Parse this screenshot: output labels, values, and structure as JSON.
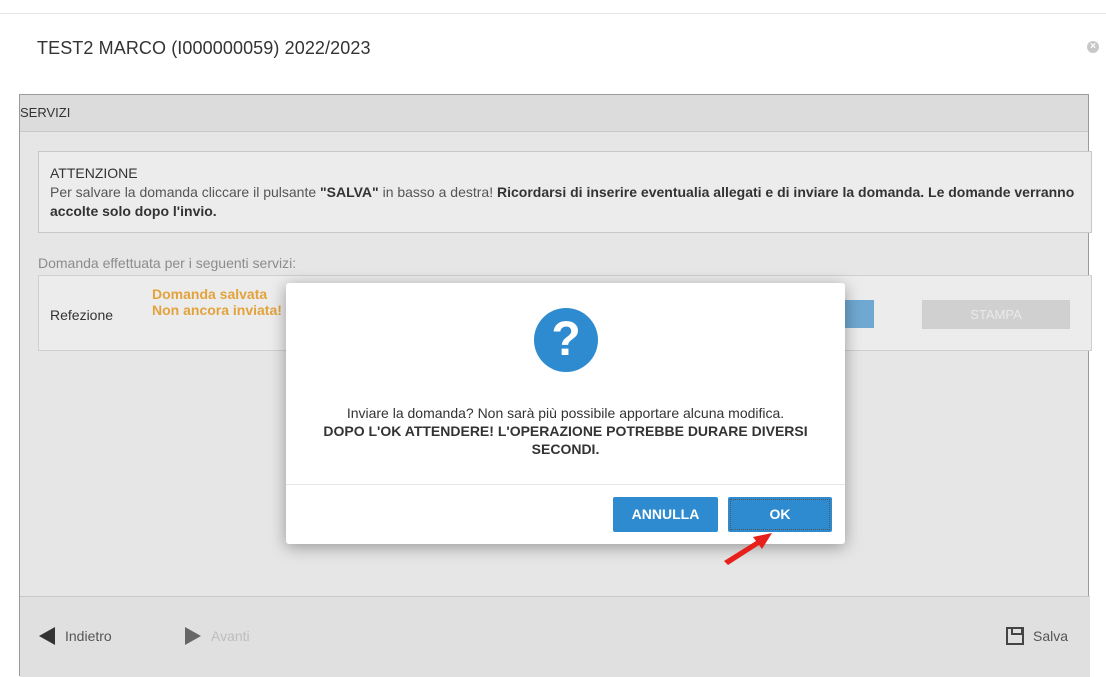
{
  "window": {
    "title": "TEST2 MARCO (I000000059) 2022/2023",
    "close_glyph": "×"
  },
  "panel": {
    "header": "SERVIZI",
    "notice": {
      "heading": "ATTENZIONE",
      "text_1": "Per salvare la domanda cliccare il pulsante ",
      "salva_ref": "\"SALVA\"",
      "text_2": " in basso a destra! ",
      "bold_tail": "Ricordarsi di inserire eventualia allegati e di inviare la domanda. Le domande verranno accolte solo dopo l'invio."
    },
    "services_caption": "Domanda effettuata per i seguenti servizi:",
    "service": {
      "name": "Refezione",
      "status_1": "Domanda salvata",
      "status_2": "Non ancora inviata!",
      "print_label": "STAMPA"
    }
  },
  "footer": {
    "back_label": "Indietro",
    "forward_label": "Avanti",
    "save_label": "Salva"
  },
  "dialog": {
    "icon": "question-icon",
    "icon_glyph": "?",
    "message": "Inviare la domanda? Non sarà più possibile apportare alcuna modifica.",
    "warning": "DOPO L'OK ATTENDERE! L'OPERAZIONE POTREBBE DURARE DIVERSI SECONDI.",
    "cancel_label": "ANNULLA",
    "ok_label": "OK"
  },
  "colors": {
    "accent": "#2e8bcf",
    "status": "#e3a33c",
    "annotation_arrow": "#e8201c"
  }
}
